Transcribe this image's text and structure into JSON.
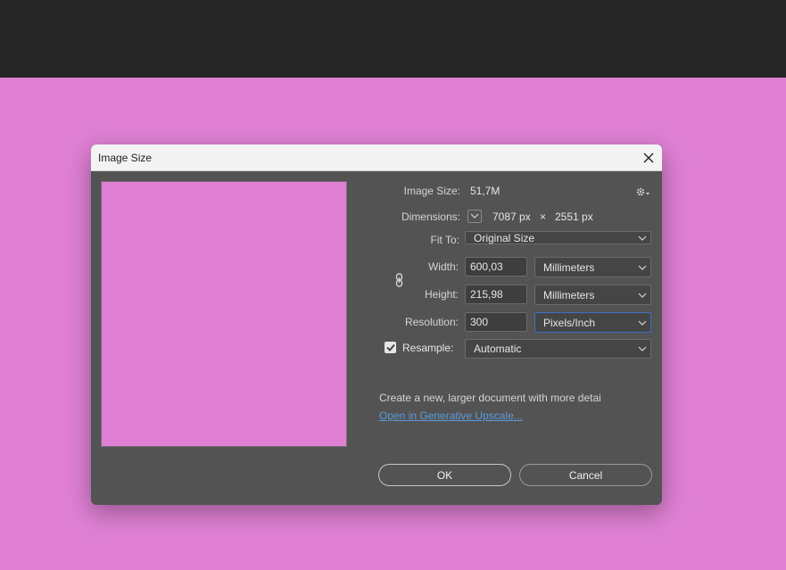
{
  "dialog": {
    "title": "Image Size",
    "close_icon": "close-icon"
  },
  "image_size": {
    "label": "Image Size:",
    "value": "51,7M"
  },
  "dimensions": {
    "label": "Dimensions:",
    "width": "7087 px",
    "times": "×",
    "height": "2551 px"
  },
  "fit_to": {
    "label": "Fit To:",
    "value": "Original Size"
  },
  "width": {
    "label": "Width:",
    "value": "600,03",
    "unit": "Millimeters"
  },
  "height": {
    "label": "Height:",
    "value": "215,98",
    "unit": "Millimeters"
  },
  "resolution": {
    "label": "Resolution:",
    "value": "300",
    "unit": "Pixels/Inch"
  },
  "resample": {
    "label": "Resample:",
    "checked": true,
    "value": "Automatic"
  },
  "info_text": "Create a new, larger document with more detai",
  "generative_link": "Open in Generative Upscale...",
  "buttons": {
    "ok": "OK",
    "cancel": "Cancel"
  },
  "colors": {
    "canvas": "#df80d4",
    "dialog_bg": "#535353",
    "topbar": "#262626",
    "link": "#5b9bd9",
    "focus_border": "#3d6fc4"
  }
}
